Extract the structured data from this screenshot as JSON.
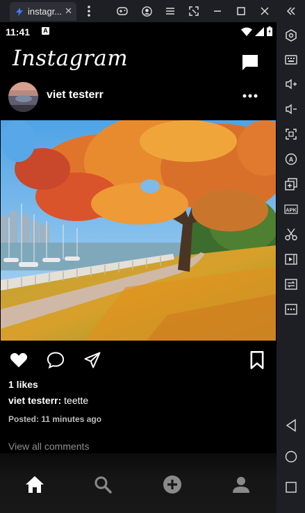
{
  "emulator": {
    "tab_title": "instagr...",
    "tab_close": "✕",
    "accent": "#3d7bfd",
    "toolbar_icons": [
      "gamepad-icon",
      "account-icon",
      "menu-icon",
      "screenshot-icon",
      "minimize-icon",
      "maximize-icon",
      "close-icon",
      "collapse-icon"
    ],
    "sidebar_icons": [
      "settings-icon",
      "keyboard-icon",
      "volume-up-icon",
      "volume-down-icon",
      "fullscreen-icon",
      "auto-icon",
      "multi-instance-icon",
      "apk-icon",
      "cut-icon",
      "record-icon",
      "sync-icon",
      "more-icon",
      "back-icon",
      "home-icon",
      "recents-icon"
    ],
    "apk_label": "APK"
  },
  "status": {
    "time": "11:41",
    "notification": "A"
  },
  "app": {
    "name": "Instagram"
  },
  "post": {
    "username": "viet testerr",
    "likes": "1 likes",
    "caption_user": "viet testerr:",
    "caption_text": "teette",
    "posted_label": "Posted:",
    "posted_time": "11 minutes ago",
    "view_comments": "View all comments"
  },
  "nav": {
    "items": [
      "home-icon",
      "search-icon",
      "add-post-icon",
      "profile-icon"
    ]
  }
}
